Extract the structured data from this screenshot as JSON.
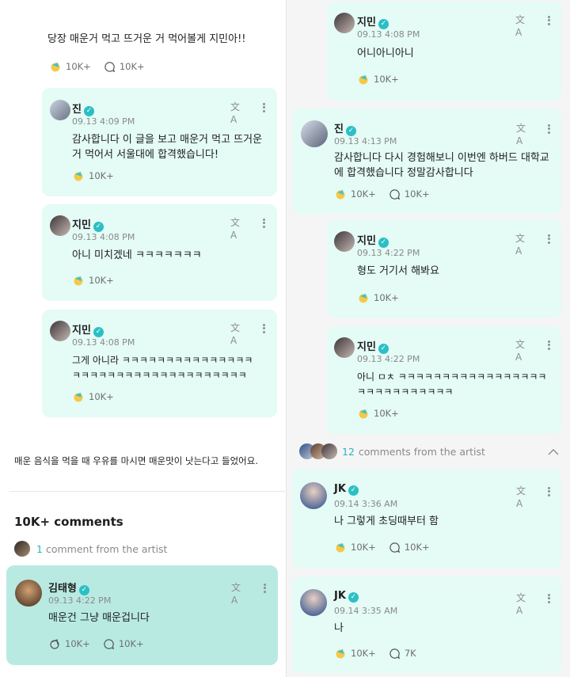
{
  "left": {
    "top_post": {
      "text": "당장 매운거 먹고 뜨거운 거 먹어볼게 지민아!!",
      "likes": "10K+",
      "comments": "10K+"
    },
    "replies": [
      {
        "name": "진",
        "time": "09.13 4:09 PM",
        "text": "감사합니다 이 글을 보고 매운거 먹고 뜨거운거 먹어서 서울대에 합격했습니다!",
        "likes": "10K+"
      },
      {
        "name": "지민",
        "time": "09.13 4:08 PM",
        "text": "아니 미치겠네 ㅋㅋㅋㅋㅋㅋㅋ",
        "likes": "10K+"
      },
      {
        "name": "지민",
        "time": "09.13 4:08 PM",
        "text": "그게 아니라 ㅋㅋㅋㅋㅋㅋㅋㅋㅋㅋㅋㅋㅋㅋㅋㅋㅋㅋㅋㅋㅋㅋㅋㅋㅋㅋㅋㅋㅋㅋㅋㅋㅋㅋㅋ",
        "likes": "10K+"
      }
    ],
    "post_text": "매운 음식을 먹을 때 우유를 마시면 매운맛이 낫는다고 들었어요.",
    "comments_title": "10K+ comments",
    "artist_count": "1",
    "artist_label": "comment from the artist",
    "selected_comment": {
      "name": "김태형",
      "time": "09.13 4:22 PM",
      "text": "매운건 그냥 매운겁니다",
      "likes": "10K+",
      "comments": "10K+"
    }
  },
  "right": {
    "replies_top": [
      {
        "name": "지민",
        "time": "09.13 4:08 PM",
        "text": "어니아니아니",
        "likes": "10K+"
      }
    ],
    "jin_comment": {
      "name": "진",
      "time": "09.13 4:13 PM",
      "text": "감사합니다 다시 경험해보니 이번엔 하버드 대학교에 합격했습니다 정말감사합니다",
      "likes": "10K+",
      "comments": "10K+"
    },
    "replies_bottom": [
      {
        "name": "지민",
        "time": "09.13 4:22 PM",
        "text": "형도 거기서 해봐요",
        "likes": "10K+"
      },
      {
        "name": "지민",
        "time": "09.13 4:22 PM",
        "text": "아니 ㅁㅊ ㅋㅋㅋㅋㅋㅋㅋㅋㅋㅋㅋㅋㅋㅋㅋㅋㅋㅋㅋㅋㅋㅋㅋㅋㅋㅋㅋㅋ",
        "likes": "10K+"
      }
    ],
    "artist_count": "12",
    "artist_label": "comments from the artist",
    "jk_comments": [
      {
        "name": "JK",
        "time": "09.14 3:36 AM",
        "text": "나 그렇게 초딩때부터 함",
        "likes": "10K+",
        "comments": "10K+"
      },
      {
        "name": "JK",
        "time": "09.14 3:35 AM",
        "text": "나",
        "likes": "10K+",
        "comments": "7K"
      }
    ]
  },
  "icons": {
    "translate": "文A",
    "verified": "✓"
  },
  "colors": {
    "accent": "#2bb3b8",
    "card": "#e4fbf6",
    "card_selected": "#b8eae2"
  }
}
